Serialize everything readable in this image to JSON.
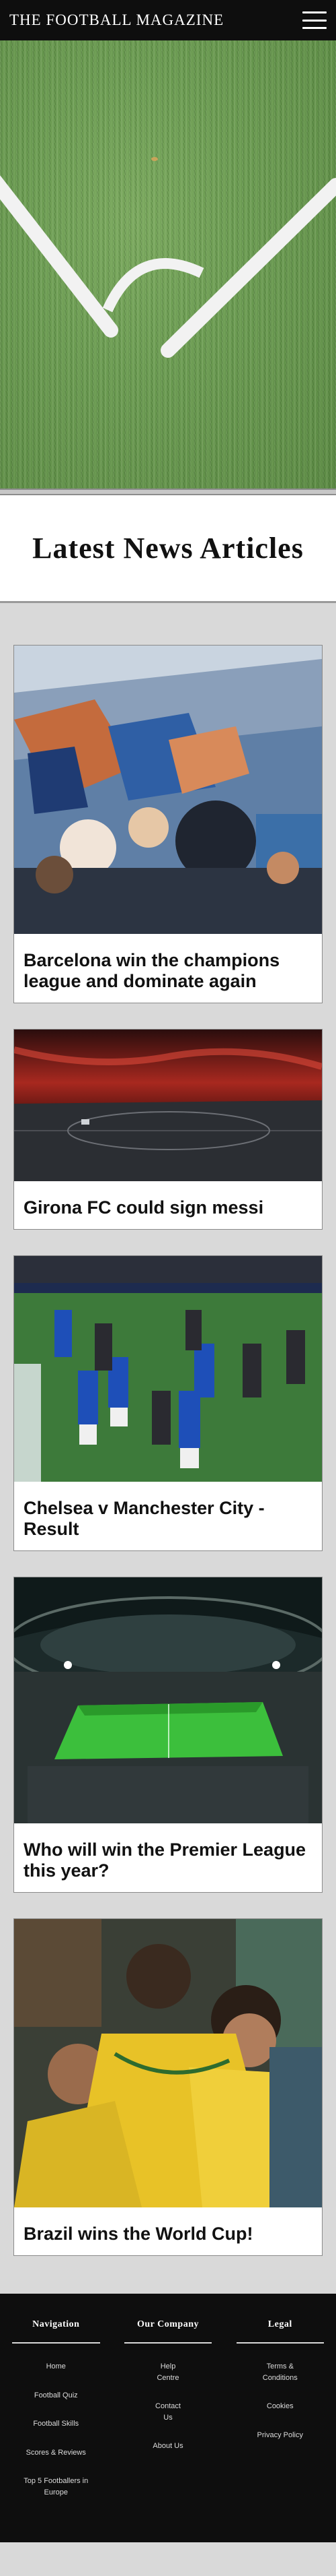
{
  "header": {
    "brand": "THE FOOTBALL MAGAZINE",
    "menu_icon": "hamburger-menu-icon"
  },
  "hero": {
    "image": "football pitch corner marking on grass"
  },
  "section": {
    "title": "Latest News Articles"
  },
  "articles": [
    {
      "title": "Barcelona win the champions league and dominate again",
      "image": "stadium crowd with blue and red flags"
    },
    {
      "title": "Girona FC could sign messi",
      "image": "stadium under red sunset sky"
    },
    {
      "title": "Chelsea v Manchester City - Result",
      "image": "players on pitch in blue and dark kits"
    },
    {
      "title": "Who will win the Premier League this year?",
      "image": "illuminated stadium at night"
    },
    {
      "title": "Brazil wins the World Cup!",
      "image": "fans in yellow shirts celebrating"
    }
  ],
  "footer": {
    "columns": [
      {
        "heading": "Navigation",
        "links": [
          "Home",
          "Football Quiz",
          "Football Skills",
          "Scores & Reviews",
          "Top 5 Footballers in Europe"
        ]
      },
      {
        "heading": "Our Company",
        "links": [
          "Help Centre",
          "Contact Us",
          "About Us"
        ]
      },
      {
        "heading": "Legal",
        "links": [
          "Terms & Conditions",
          "Cookies",
          "Privacy Policy"
        ]
      }
    ]
  },
  "colors": {
    "header_bg": "#0e0e0e",
    "page_bg": "#d9d9d9",
    "card_bg": "#ffffff",
    "text": "#111111"
  }
}
